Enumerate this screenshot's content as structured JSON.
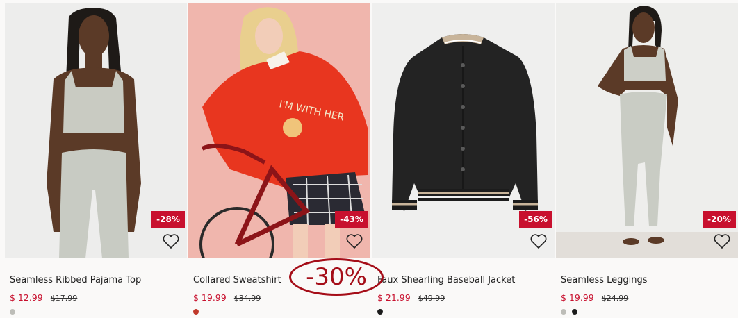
{
  "products": [
    {
      "title": "Seamless Ribbed Pajama Top",
      "price": "$ 12.99",
      "old_price": "$17.99",
      "discount": "-28%",
      "swatches": [
        "#bdbdb8"
      ]
    },
    {
      "title": "Collared Sweatshirt",
      "price": "$ 19.99",
      "old_price": "$34.99",
      "discount": "-43%",
      "swatches": [
        "#c0392b"
      ]
    },
    {
      "title": "Faux Shearling Baseball Jacket",
      "price": "$ 21.99",
      "old_price": "$49.99",
      "discount": "-56%",
      "swatches": [
        "#1b1b1b"
      ]
    },
    {
      "title": "Seamless Leggings",
      "price": "$ 19.99",
      "old_price": "$24.99",
      "discount": "-20%",
      "swatches": [
        "#bdbdb8",
        "#1b1b1b"
      ]
    }
  ],
  "promo_badge": "-30%",
  "colors": {
    "sale_red": "#c8102e",
    "promo_red": "#a50d18"
  },
  "icons": {
    "favorite": "heart-icon"
  }
}
